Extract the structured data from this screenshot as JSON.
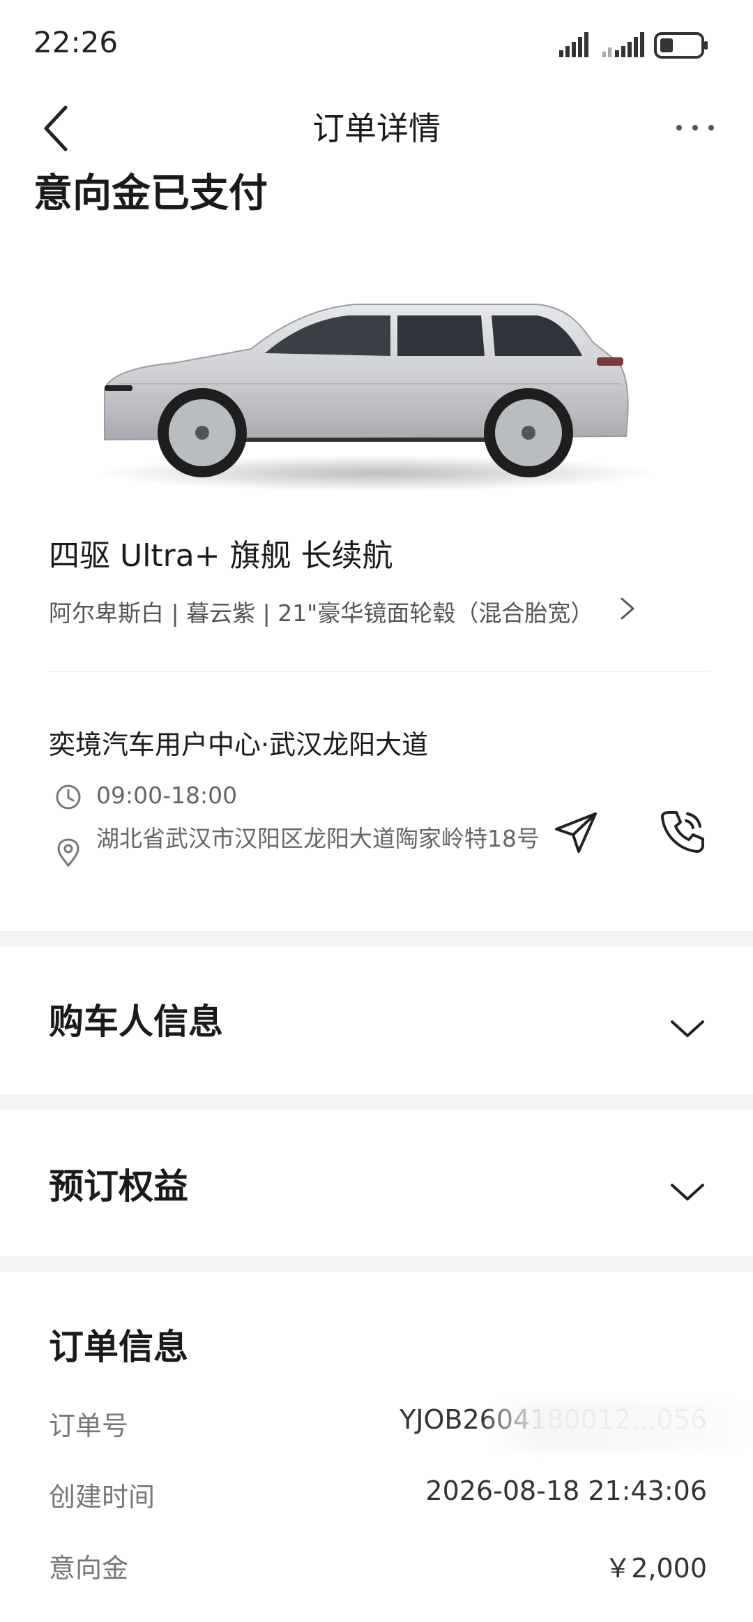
{
  "status_bar": {
    "time": "22:26"
  },
  "nav": {
    "title": "订单详情",
    "back_icon": "back-chevron-icon",
    "more_icon": "more-dots-icon"
  },
  "order_status": "意向金已支付",
  "vehicle": {
    "model": "四驱 Ultra+ 旗舰 长续航",
    "config": "阿尔卑斯白 | 暮云紫 | 21\"豪华镜面轮毂（混合胎宽）"
  },
  "store": {
    "name": "奕境汽车用户中心·武汉龙阳大道",
    "hours": "09:00-18:00",
    "address": "湖北省武汉市汉阳区龙阳大道陶家岭特18号"
  },
  "sections": {
    "buyer_info": "购车人信息",
    "benefits": "预订权益",
    "order_info": "订单信息"
  },
  "order_info": {
    "order_no_label": "订单号",
    "order_no_value": "YJOB2604180012...056",
    "created_label": "创建时间",
    "created_value": "2026-08-18 21:43:06",
    "deposit_label": "意向金",
    "deposit_value": "￥2,000"
  },
  "colors": {
    "background": "#ffffff",
    "text_primary": "#1a1a1a",
    "text_secondary": "#666666",
    "section_gap": "#f3f3f3"
  }
}
